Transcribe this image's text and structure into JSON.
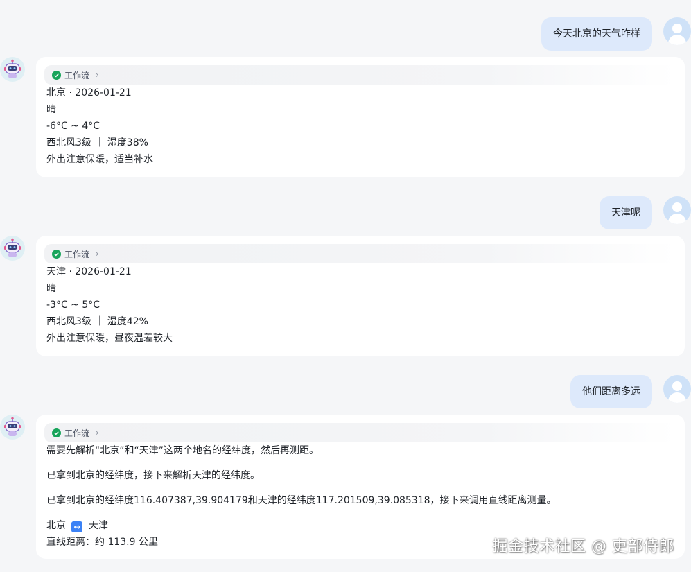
{
  "conversation": [
    {
      "user": "今天北京的天气咋样",
      "workflow_label": "工作流",
      "lines": [
        "北京 · 2026-01-21",
        "晴",
        "-6°C ~ 4°C",
        "西北风3级 ｜ 湿度38%",
        "外出注意保暖，适当补水"
      ]
    },
    {
      "user": "天津呢",
      "workflow_label": "工作流",
      "lines": [
        "天津 · 2026-01-21",
        "晴",
        "-3°C ~ 5°C",
        "西北风3级 ｜ 湿度42%",
        "外出注意保暖，昼夜温差较大"
      ]
    },
    {
      "user": "他们距离多远",
      "workflow_label": "工作流",
      "paragraphs": [
        "需要先解析“北京”和“天津”这两个地名的经纬度，然后再测距。",
        "已拿到北京的经纬度，接下来解析天津的经纬度。",
        "已拿到北京的经纬度116.407387,39.904179和天津的经纬度117.201509,39.085318，接下来调用直线距离测量。"
      ],
      "route": {
        "from": "北京",
        "arrow": "↔",
        "to": "天津"
      },
      "distance": "直线距离：约 113.9 公里"
    }
  ],
  "watermark": "掘金技术社区 @ 吏部侍郎",
  "icons": {
    "user_avatar": "user-avatar-icon",
    "bot_avatar": "robot-avatar-icon",
    "workflow_status": "check-circle-icon",
    "expand": "chevron-right-icon"
  },
  "colors": {
    "background": "#f5f6f8",
    "user_bubble": "#dde9fb",
    "card": "#ffffff",
    "success": "#17a45a",
    "route_arrow": "#3b82f6"
  }
}
